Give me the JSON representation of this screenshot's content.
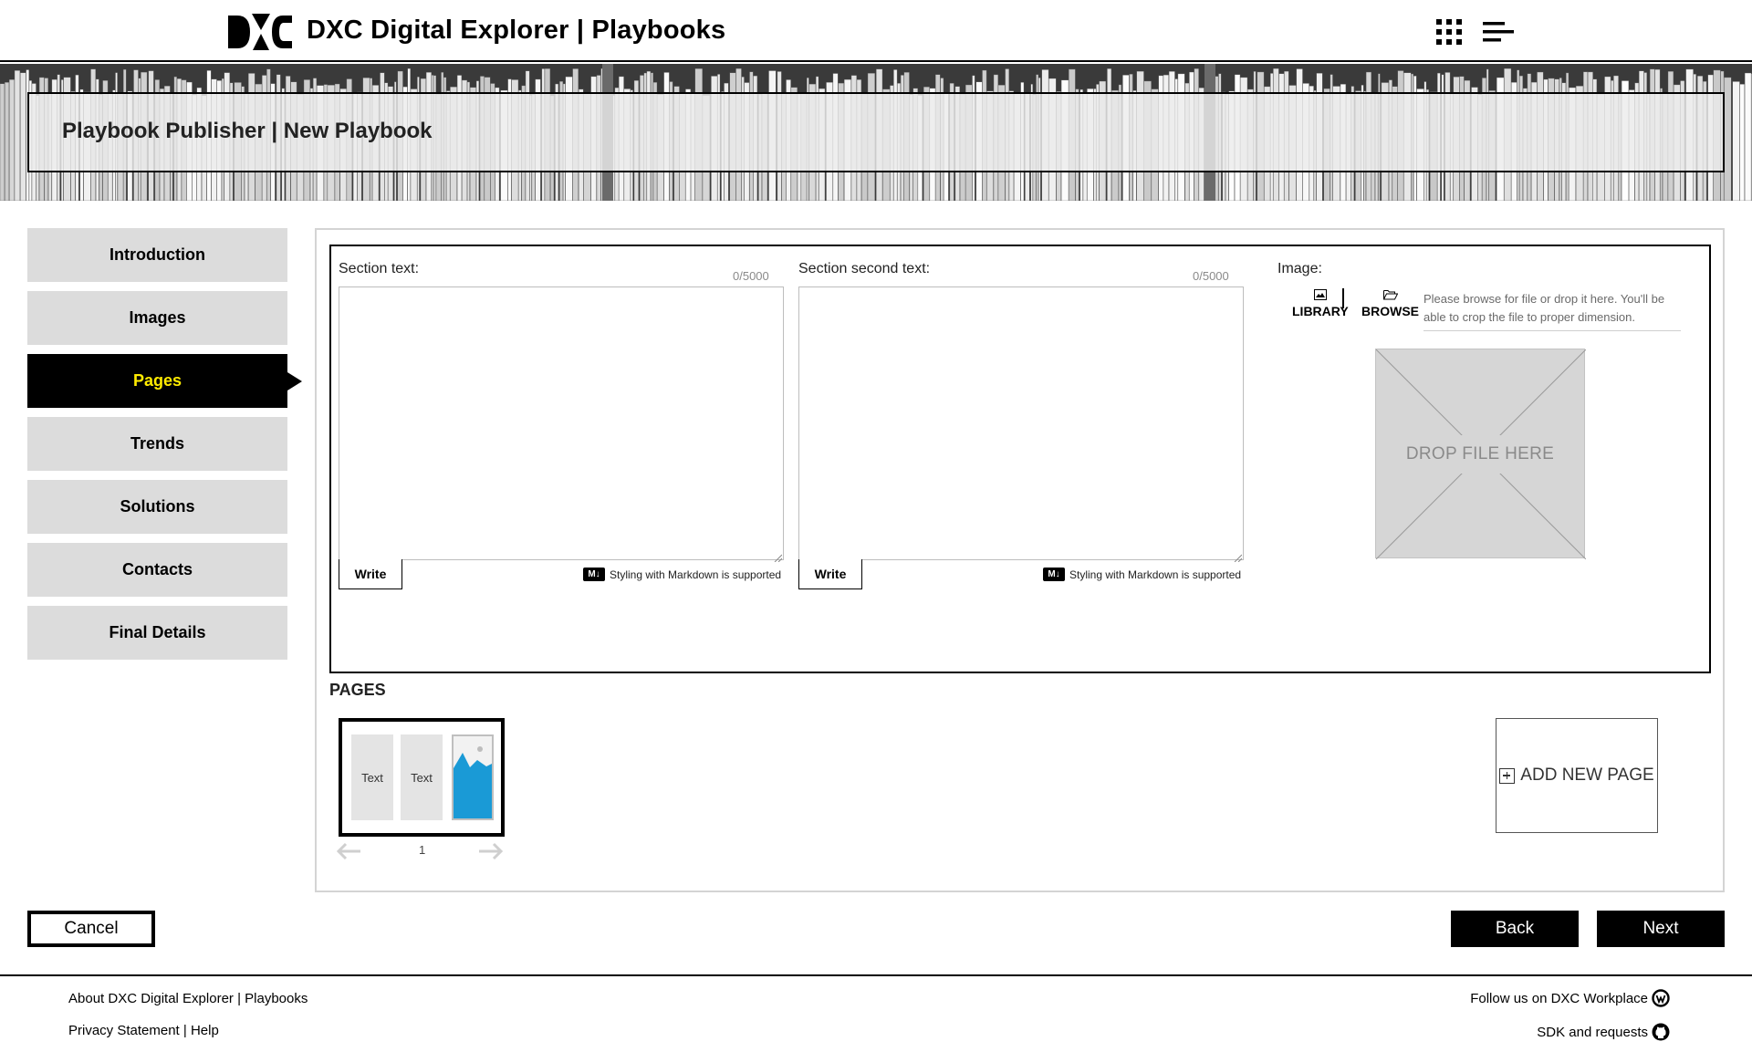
{
  "header": {
    "app_title": "DXC Digital Explorer | Playbooks",
    "logo_icon": "dxc-logo-icon",
    "apps_icon": "apps-grid-icon",
    "menu_icon": "menu-lines-icon"
  },
  "banner": {
    "title": "Playbook Publisher | New Playbook"
  },
  "sidebar": {
    "items": [
      {
        "label": "Introduction",
        "active": false
      },
      {
        "label": "Images",
        "active": false
      },
      {
        "label": "Pages",
        "active": true
      },
      {
        "label": "Trends",
        "active": false
      },
      {
        "label": "Solutions",
        "active": false
      },
      {
        "label": "Contacts",
        "active": false
      },
      {
        "label": "Final Details",
        "active": false
      }
    ],
    "active_color": "#ffeb00"
  },
  "editor": {
    "section_text": {
      "label": "Section text:",
      "counter": "0/5000",
      "value": "",
      "write_label": "Write",
      "markdown_badge": "M↓",
      "markdown_note": "Styling with Markdown is supported"
    },
    "section_second_text": {
      "label": "Section second text:",
      "counter": "0/5000",
      "value": "",
      "write_label": "Write",
      "markdown_badge": "M↓",
      "markdown_note": "Styling with Markdown is supported"
    },
    "image": {
      "label": "Image:",
      "library_label": "LIBRARY",
      "browse_label": "BROWSE",
      "hint": "Please browse for file or drop it here. You'll be able to crop the file to proper dimension.",
      "dropzone_label": "DROP FILE HERE"
    }
  },
  "pages": {
    "heading": "PAGES",
    "thumbnail": {
      "col1": "Text",
      "col2": "Text",
      "image_color": "#1a9ad6"
    },
    "current_page": "1",
    "add_page_label": "ADD NEW PAGE"
  },
  "actions": {
    "cancel": "Cancel",
    "back": "Back",
    "next": "Next"
  },
  "footer": {
    "about": "About DXC Digital Explorer | Playbooks",
    "privacy": "Privacy Statement | Help",
    "follow": "Follow us on DXC Workplace",
    "sdk": "SDK and requests"
  }
}
